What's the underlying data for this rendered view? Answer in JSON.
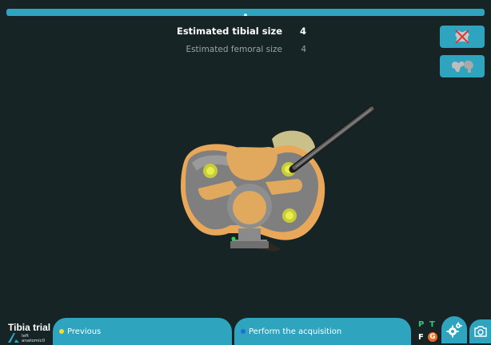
{
  "sizes": {
    "tibial_label": "Estimated tibial size",
    "tibial_value": "4",
    "femoral_label": "Estimated femoral size",
    "femoral_value": "4"
  },
  "bottom": {
    "mode_title": "Tibia trial",
    "side_label_line1": "left",
    "side_label_line2": "anatomic0",
    "previous_label": "Previous",
    "acquire_label": "Perform the acquisition"
  },
  "status": {
    "p": "P",
    "t": "T",
    "f": "F",
    "g": "G"
  },
  "colors": {
    "background": "#162426",
    "accent": "#2fa4bf",
    "active_green": "#2ecc71",
    "warning_orange": "#f06a1a",
    "dot_yellow": "#f1e21b",
    "dot_blue": "#1e6fd9"
  },
  "icons": {
    "hide_bone": "bone-hidden-icon",
    "show_bone": "bone-icon",
    "settings": "gears-icon",
    "camera": "camera-icon",
    "logo": "logo-mark-icon"
  }
}
